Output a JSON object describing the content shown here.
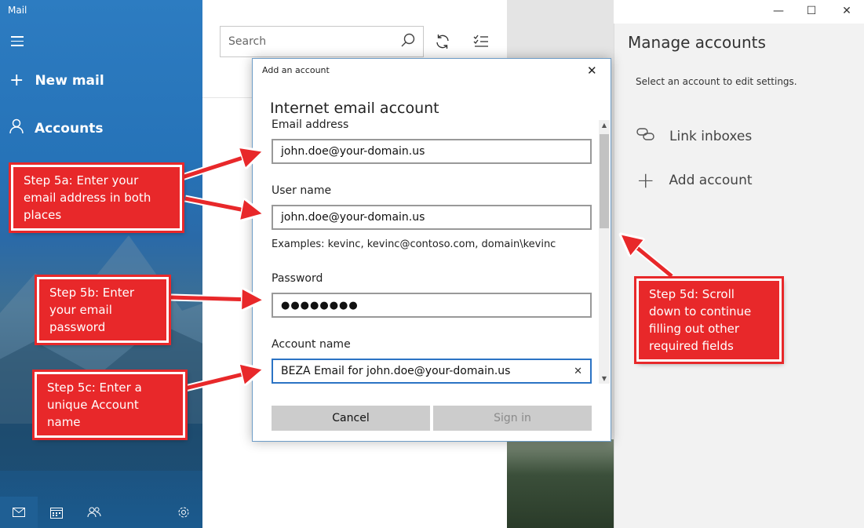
{
  "app": {
    "title": "Mail"
  },
  "nav": {
    "new_mail": "New mail",
    "accounts": "Accounts",
    "bottom_icons": [
      "mail-icon",
      "calendar-icon",
      "people-icon",
      "settings-icon"
    ]
  },
  "search": {
    "placeholder": "Search"
  },
  "window_controls": {
    "minimize": "—",
    "maximize": "☐",
    "close": "✕"
  },
  "manage_accounts": {
    "title": "Manage accounts",
    "subtitle": "Select an account to edit settings.",
    "items": [
      {
        "label": "Link inboxes",
        "icon": "link-icon"
      },
      {
        "label": "Add account",
        "icon": "plus-icon"
      }
    ]
  },
  "dialog": {
    "title": "Add an account",
    "heading": "Internet email account",
    "email_label": "Email address",
    "email_value": "john.doe@your-domain.us",
    "username_label": "User name",
    "username_value": "john.doe@your-domain.us",
    "username_hint": "Examples: kevinc, kevinc@contoso.com, domain\\kevinc",
    "password_label": "Password",
    "password_value": "●●●●●●●●",
    "account_name_label": "Account name",
    "account_name_value": "BEZA Email for john.doe@your-domain.us",
    "cancel": "Cancel",
    "sign_in": "Sign in"
  },
  "callouts": {
    "step5a": "Step 5a: Enter your email address in both places",
    "step5b": "Step 5b: Enter your email password",
    "step5c": "Step 5c: Enter a unique Account name",
    "step5d": "Step 5d: Scroll down to continue filling out other required fields"
  },
  "colors": {
    "accent": "#2b73c4",
    "callout": "#e8282a",
    "nav": "#2673b8"
  }
}
